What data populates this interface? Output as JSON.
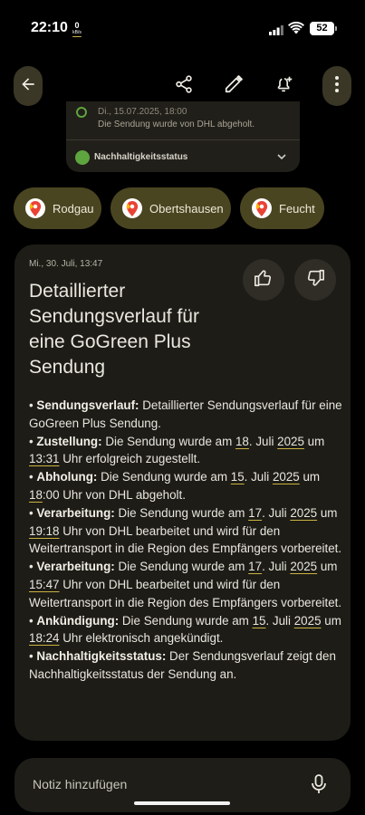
{
  "status_bar": {
    "time": "22:10",
    "net_speed_value": "0",
    "net_speed_unit": "kB/s",
    "battery": "52"
  },
  "toolbar": {
    "icons": [
      "back-arrow-icon",
      "share-icon",
      "edit-pencil-icon",
      "add-reminder-icon",
      "more-vert-icon"
    ]
  },
  "snippet": {
    "date_text": "Di., 15.07.2025, 18:00",
    "event_text": "Die Sendung wurde von DHL abgeholt.",
    "section_label": "Nachhaltigkeitsstatus"
  },
  "chips": [
    {
      "label": "Rodgau"
    },
    {
      "label": "Obertshausen"
    },
    {
      "label": "Feucht"
    }
  ],
  "card": {
    "date": "Mi., 30. Juli, 13:47",
    "title": "Detaillierter Sendungsverlauf für eine GoGreen Plus Sendung"
  },
  "note": {
    "placeholder": "Notiz hinzufügen"
  },
  "colors": {
    "background": "#000000",
    "chip_bg": "#4a4521",
    "card_bg": "#1d1c17",
    "accent_underline": "#c9b341",
    "green_status": "#5fa53f"
  }
}
